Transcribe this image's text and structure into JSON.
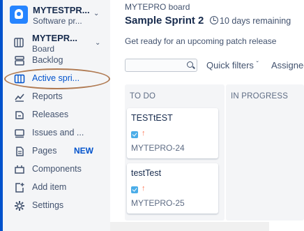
{
  "sidebar": {
    "project": {
      "name": "MYTESTPR...",
      "type": "Software pr..."
    },
    "board_selector": {
      "name": "MYTEPR...",
      "sub_line1": "Board"
    },
    "items": [
      {
        "label": "Backlog",
        "icon": "backlog-icon"
      },
      {
        "label": "Active spri...",
        "icon": "board-icon",
        "active": true
      },
      {
        "label": "Reports",
        "icon": "reports-icon"
      },
      {
        "label": "Releases",
        "icon": "releases-icon"
      },
      {
        "label": "Issues and ...",
        "icon": "issues-icon"
      },
      {
        "label": "Pages",
        "icon": "pages-icon",
        "badge": "NEW"
      },
      {
        "label": "Components",
        "icon": "components-icon"
      },
      {
        "label": "Add item",
        "icon": "add-item-icon"
      },
      {
        "label": "Settings",
        "icon": "settings-icon"
      }
    ]
  },
  "header": {
    "breadcrumb": "MYTEPRO board",
    "title": "Sample Sprint 2",
    "remaining": "10 days remaining",
    "goal": "Get ready for an upcoming patch release"
  },
  "toolbar": {
    "search_placeholder": "",
    "quick_filters": "Quick filters",
    "assignee": "Assignee"
  },
  "columns": [
    {
      "title": "TO DO",
      "cards": [
        {
          "title": "TESTtEST",
          "key": "MYTEPRO-24",
          "priority": "↑"
        },
        {
          "title": "testTest",
          "key": "MYTEPRO-25",
          "priority": "↑"
        }
      ]
    },
    {
      "title": "IN PROGRESS",
      "cards": []
    }
  ],
  "colors": {
    "accent": "#0052cc",
    "priority": "#ff7452",
    "story": "#4bade8",
    "highlight": "#b07a52"
  }
}
